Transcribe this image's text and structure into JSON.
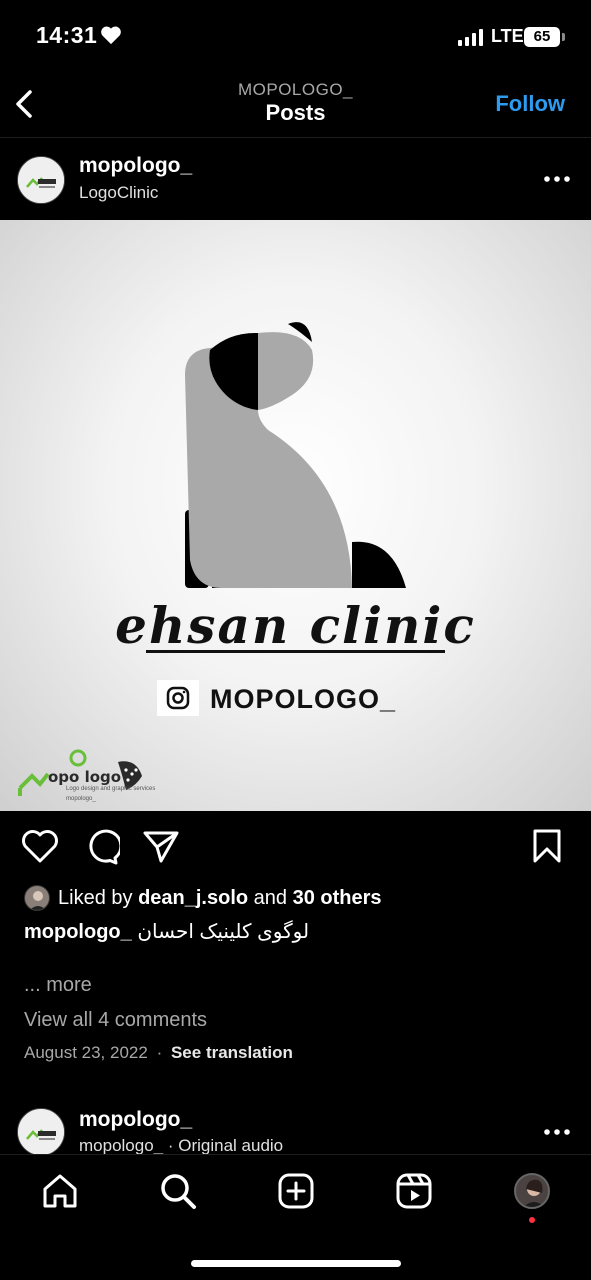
{
  "status_bar": {
    "time": "14:31",
    "network": "LTE",
    "battery": "65"
  },
  "header": {
    "account": "MOPOLOGO_",
    "title": "Posts",
    "follow_label": "Follow"
  },
  "post": {
    "username": "mopologo_",
    "subtitle": "LogoClinic",
    "image": {
      "brand_text": "ehsan clinic",
      "ig_handle": "MOPOLOGO_",
      "watermark_text": "opo logo",
      "watermark_tagline": "Logo design and graphic services",
      "watermark_handle": "mopologo_"
    },
    "likes": {
      "prefix": "Liked by",
      "user": "dean_j.solo",
      "middle": "and",
      "others": "30 others"
    },
    "caption_user": "mopologo_",
    "caption_text": "لوگوی کلینیک احسان",
    "more_label": "... more",
    "comments_label": "View all 4 comments",
    "date": "August 23, 2022",
    "separator": "·",
    "see_translation": "See translation"
  },
  "next_post": {
    "username": "mopologo_",
    "audio": "mopologo_ · Original audio"
  },
  "tabs": [
    "home",
    "search",
    "create",
    "reels",
    "profile"
  ],
  "colors": {
    "background": "#000000",
    "accent": "#2d9bf0",
    "secondary_text": "#a8a8a8",
    "notification": "#ff3040"
  }
}
